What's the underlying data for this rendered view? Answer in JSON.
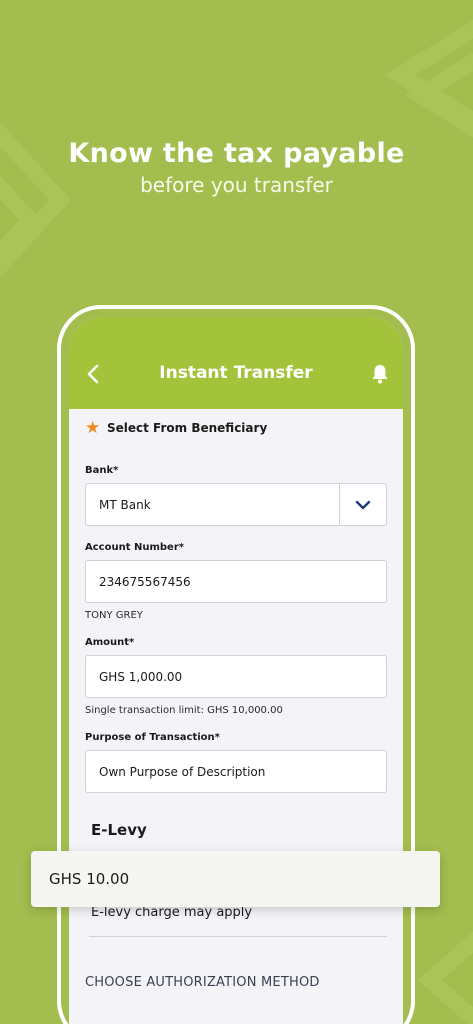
{
  "headline": {
    "title": "Know the tax payable",
    "subtitle": "before you transfer"
  },
  "appbar": {
    "title": "Instant Transfer",
    "back_icon": "chevron-left-icon",
    "bell_icon": "bell-icon"
  },
  "beneficiary": {
    "icon": "star-icon",
    "label": "Select From Beneficiary"
  },
  "form": {
    "bank_label": "Bank*",
    "bank_value": "MT Bank",
    "account_label": "Account Number*",
    "account_value": "234675567456",
    "account_name": "TONY GREY",
    "amount_label": "Amount*",
    "amount_value": "GHS 1,000.00",
    "amount_limit": "Single transaction limit: GHS 10,000.00",
    "purpose_label": "Purpose of Transaction*",
    "purpose_value": "Own Purpose of Description"
  },
  "elevy": {
    "title": "E-Levy",
    "amount": "GHS 10.00",
    "note": "E-levy charge may apply"
  },
  "authorization": {
    "label": "CHOOSE AUTHORIZATION METHOD"
  },
  "colors": {
    "background": "#a3bd4e",
    "appbar": "#a3c33a",
    "star": "#f08a1e",
    "chevron": "#1f3d78"
  }
}
